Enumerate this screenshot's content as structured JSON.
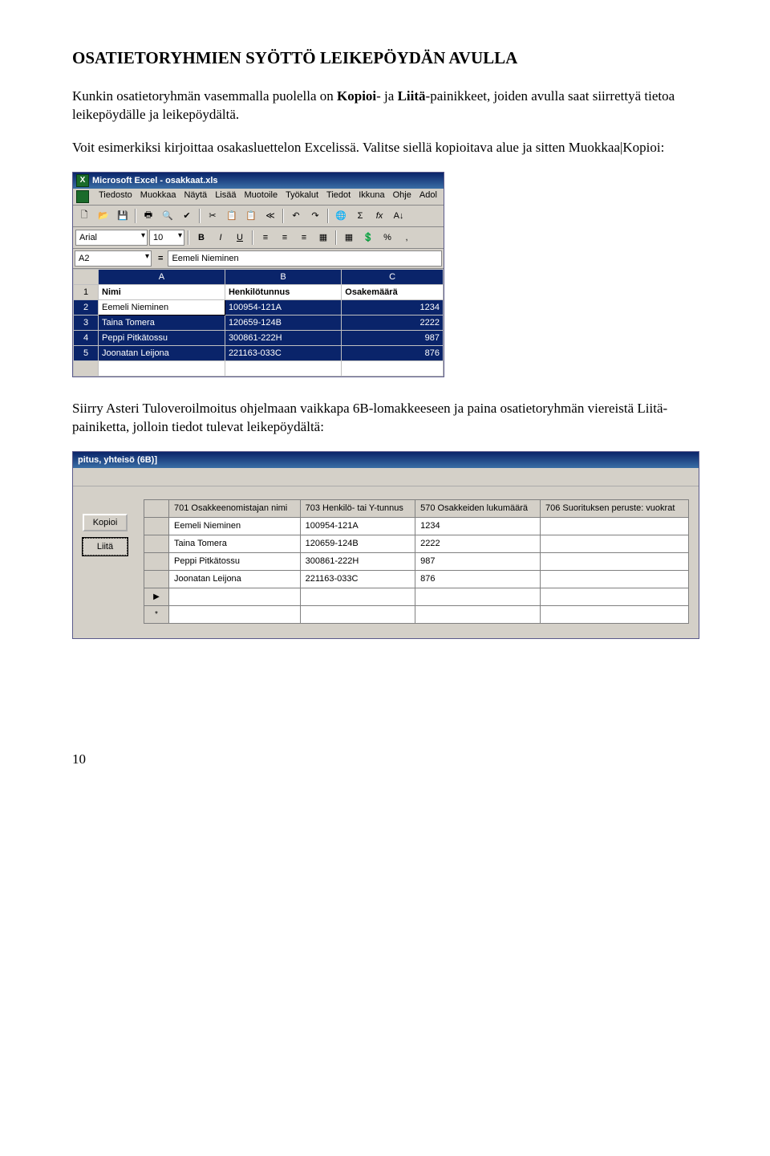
{
  "title": "OSATIETORYHMIEN SYÖTTÖ LEIKEPÖYDÄN AVULLA",
  "para1_a": "Kunkin osatietoryhmän vasemmalla puolella on ",
  "para1_kopioi": "Kopioi",
  "para1_b": "- ja ",
  "para1_liita": "Liitä",
  "para1_c": "-painikkeet, joiden avulla saat siirrettyä tietoa leikepöydälle ja leikepöydältä.",
  "para2": "Voit esimerkiksi kirjoittaa osakasluettelon Excelissä. Valitse siellä kopioitava alue ja sitten Muokkaa|Kopioi:",
  "para3": "Siirry Asteri Tuloveroilmoitus ohjelmaan vaikkapa 6B-lomakkeeseen ja paina osatietoryhmän viereistä Liitä-painiketta, jolloin tiedot tulevat leikepöydältä:",
  "excel": {
    "title": "Microsoft Excel - osakkaat.xls",
    "menus": [
      "Tiedosto",
      "Muokkaa",
      "Näytä",
      "Lisää",
      "Muotoile",
      "Työkalut",
      "Tiedot",
      "Ikkuna",
      "Ohje",
      "Adol"
    ],
    "font": "Arial",
    "fontSize": "10",
    "nameBox": "A2",
    "formula": "Eemeli Nieminen",
    "toolbarIcons": [
      "🗋",
      "📂",
      "💾",
      "🖶",
      "🔍",
      "✔",
      "✂",
      "📋",
      "📋",
      "≪",
      "↶",
      "↷",
      "Σ",
      "fx",
      "A↓"
    ],
    "toolbar2Icons": [
      "B",
      "I",
      "U",
      "≡",
      "≡",
      "≡",
      "▦",
      "▦",
      "💲",
      "%",
      ","
    ],
    "cols": [
      "",
      "A",
      "B",
      "C"
    ],
    "rows": [
      {
        "num": "1",
        "a": "Nimi",
        "b": "Henkilötunnus",
        "c": "Osakemäärä",
        "hdr": true
      },
      {
        "num": "2",
        "a": "Eemeli Nieminen",
        "b": "100954-121A",
        "c": "1234"
      },
      {
        "num": "3",
        "a": "Taina Tomera",
        "b": "120659-124B",
        "c": "2222"
      },
      {
        "num": "4",
        "a": "Peppi Pitkätossu",
        "b": "300861-222H",
        "c": "987"
      },
      {
        "num": "5",
        "a": "Joonatan Leijona",
        "b": "221163-033C",
        "c": "876"
      }
    ]
  },
  "asteri": {
    "title": "pitus, yhteisö (6B)]",
    "btnKopioi": "Kopioi",
    "btnLiita": "Liitä",
    "headers": [
      "701 Osakkeenomistajan nimi",
      "703 Henkilö- tai Y-tunnus",
      "570 Osakkeiden lukumäärä",
      "706 Suorituksen peruste: vuokrat"
    ],
    "rows": [
      {
        "a": "Eemeli Nieminen",
        "b": "100954-121A",
        "c": "1234",
        "d": ""
      },
      {
        "a": "Taina Tomera",
        "b": "120659-124B",
        "c": "2222",
        "d": ""
      },
      {
        "a": "Peppi Pitkätossu",
        "b": "300861-222H",
        "c": "987",
        "d": ""
      },
      {
        "a": "Joonatan Leijona",
        "b": "221163-033C",
        "c": "876",
        "d": ""
      }
    ],
    "markerPlay": "▶",
    "markerStar": "*"
  },
  "pageNumber": "10"
}
